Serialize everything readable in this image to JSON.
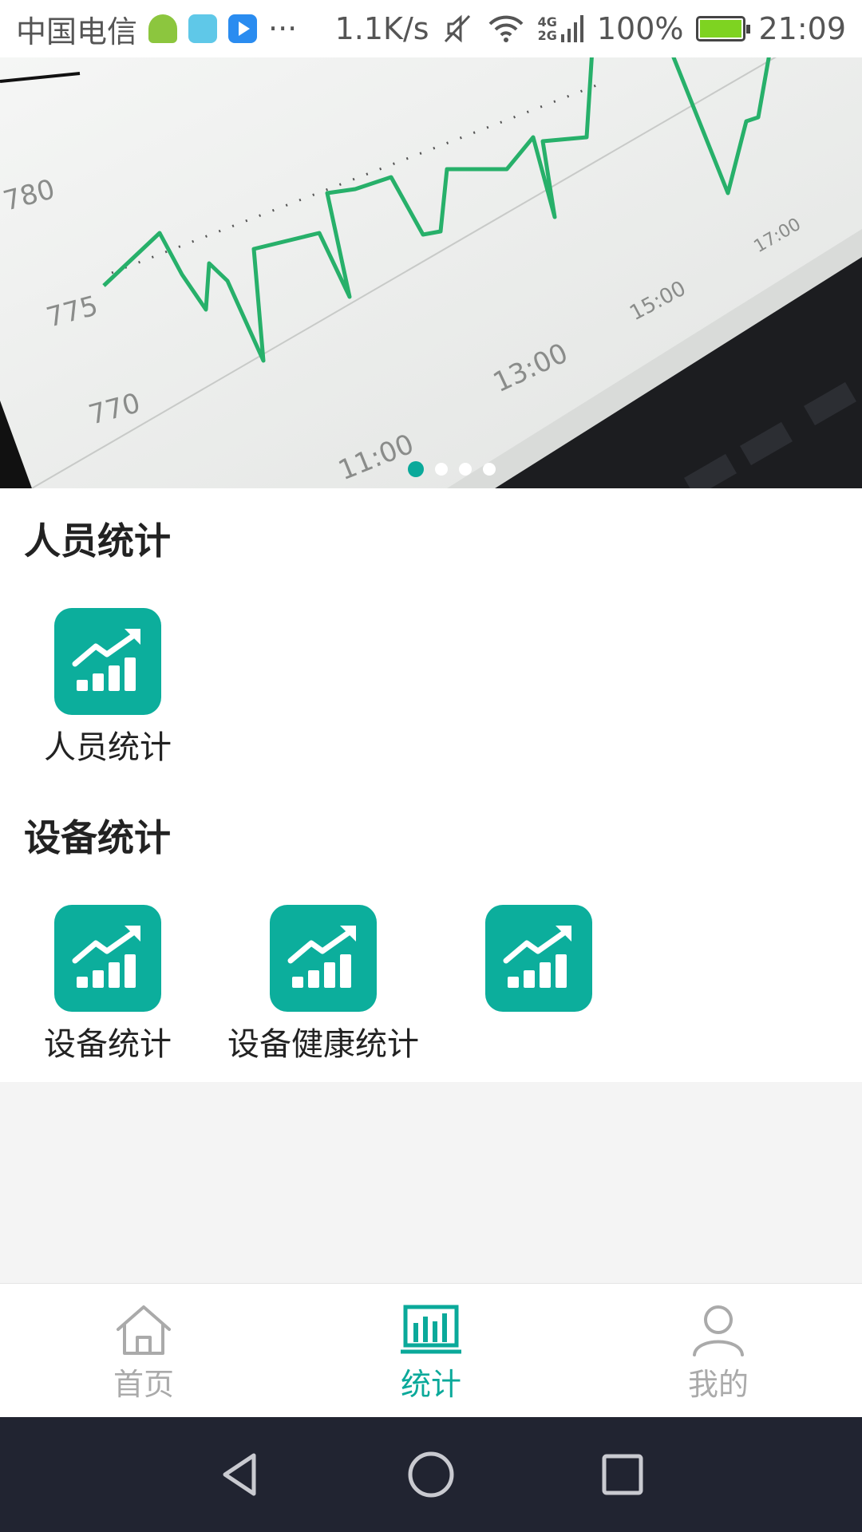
{
  "status_bar": {
    "carrier": "中国电信",
    "overflow": "···",
    "net_speed": "1.1K/s",
    "net_type_top": "4G",
    "net_type_bottom": "2G",
    "battery": "100%",
    "time": "21:09",
    "icons": [
      "android-icon",
      "robot-app-icon",
      "video-play-icon",
      "mute-icon",
      "wifi-icon",
      "signal-icon",
      "battery-charging-icon"
    ]
  },
  "banner": {
    "pages": 4,
    "active_page": 1,
    "chart_tick_labels": [
      "780",
      "775",
      "770",
      "11:00",
      "13:00",
      "15:00",
      "17:00"
    ]
  },
  "sections": [
    {
      "title": "人员统计",
      "items": [
        {
          "label": "人员统计",
          "icon": "bar-chart-trend-icon"
        }
      ]
    },
    {
      "title": "设备统计",
      "items": [
        {
          "label": "设备统计",
          "icon": "bar-chart-trend-icon"
        },
        {
          "label": "设备健康统计",
          "icon": "bar-chart-trend-icon"
        },
        {
          "label": "",
          "icon": "bar-chart-trend-icon"
        }
      ]
    }
  ],
  "tabs": [
    {
      "label": "首页",
      "icon": "home-icon",
      "active": false
    },
    {
      "label": "统计",
      "icon": "statistics-icon",
      "active": true
    },
    {
      "label": "我的",
      "icon": "user-icon",
      "active": false
    }
  ],
  "colors": {
    "accent": "#0aa99a",
    "tile": "#0cae9c",
    "inactive": "#aaaaaa",
    "nav_bar": "#212431"
  }
}
